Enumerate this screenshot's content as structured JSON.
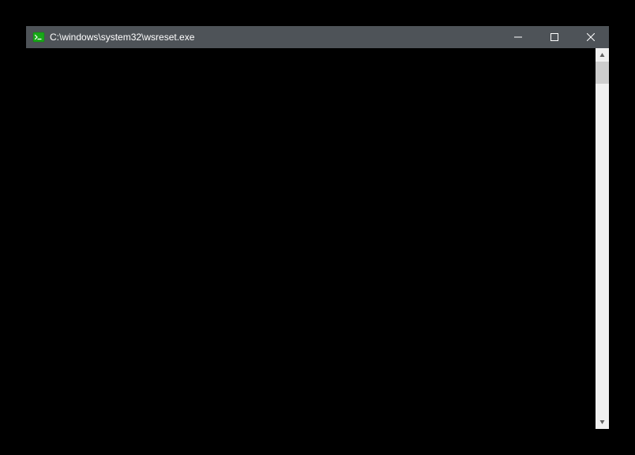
{
  "window": {
    "title": "C:\\windows\\system32\\wsreset.exe",
    "icon": "terminal-icon"
  },
  "terminal": {
    "content": ""
  },
  "controls": {
    "minimize": "minimize",
    "maximize": "maximize",
    "close": "close"
  }
}
